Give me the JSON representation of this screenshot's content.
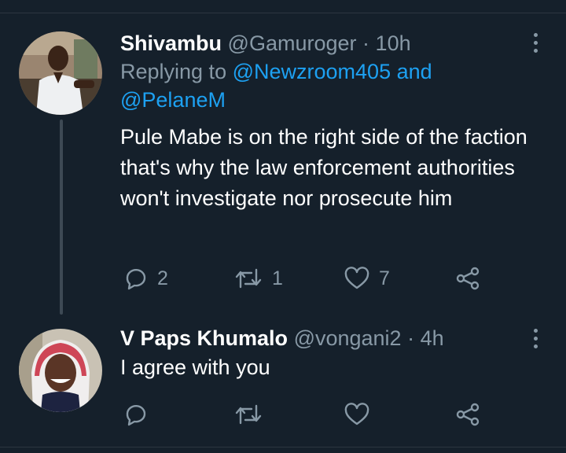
{
  "tweets": [
    {
      "name": "Shivambu",
      "handle": "@Gamuroger",
      "separator": "·",
      "time": "10h",
      "replying_prefix": "Replying to ",
      "replying_mention_1": "@Newzroom405",
      "replying_and": " and",
      "replying_mention_2": "@PelaneM",
      "text": "Pule Mabe is on the right side of the faction that's why the law enforcement authorities won't investigate nor prosecute him",
      "actions": {
        "replies": "2",
        "retweets": "1",
        "likes": "7"
      },
      "icons": [
        "reply-icon",
        "retweet-icon",
        "like-icon",
        "share-icon",
        "more-options-icon"
      ]
    },
    {
      "name": "V Paps Khumalo",
      "handle": "@vongani2",
      "separator": "·",
      "time": "4h",
      "text": "I agree with you",
      "actions": {
        "replies": "",
        "retweets": "",
        "likes": ""
      },
      "icons": [
        "reply-icon",
        "retweet-icon",
        "like-icon",
        "share-icon",
        "more-options-icon"
      ]
    }
  ],
  "colors": {
    "background": "#15202b",
    "text": "#ffffff",
    "secondary": "#8899a6",
    "mention": "#1da1f2",
    "thread_line": "#3d4954"
  }
}
